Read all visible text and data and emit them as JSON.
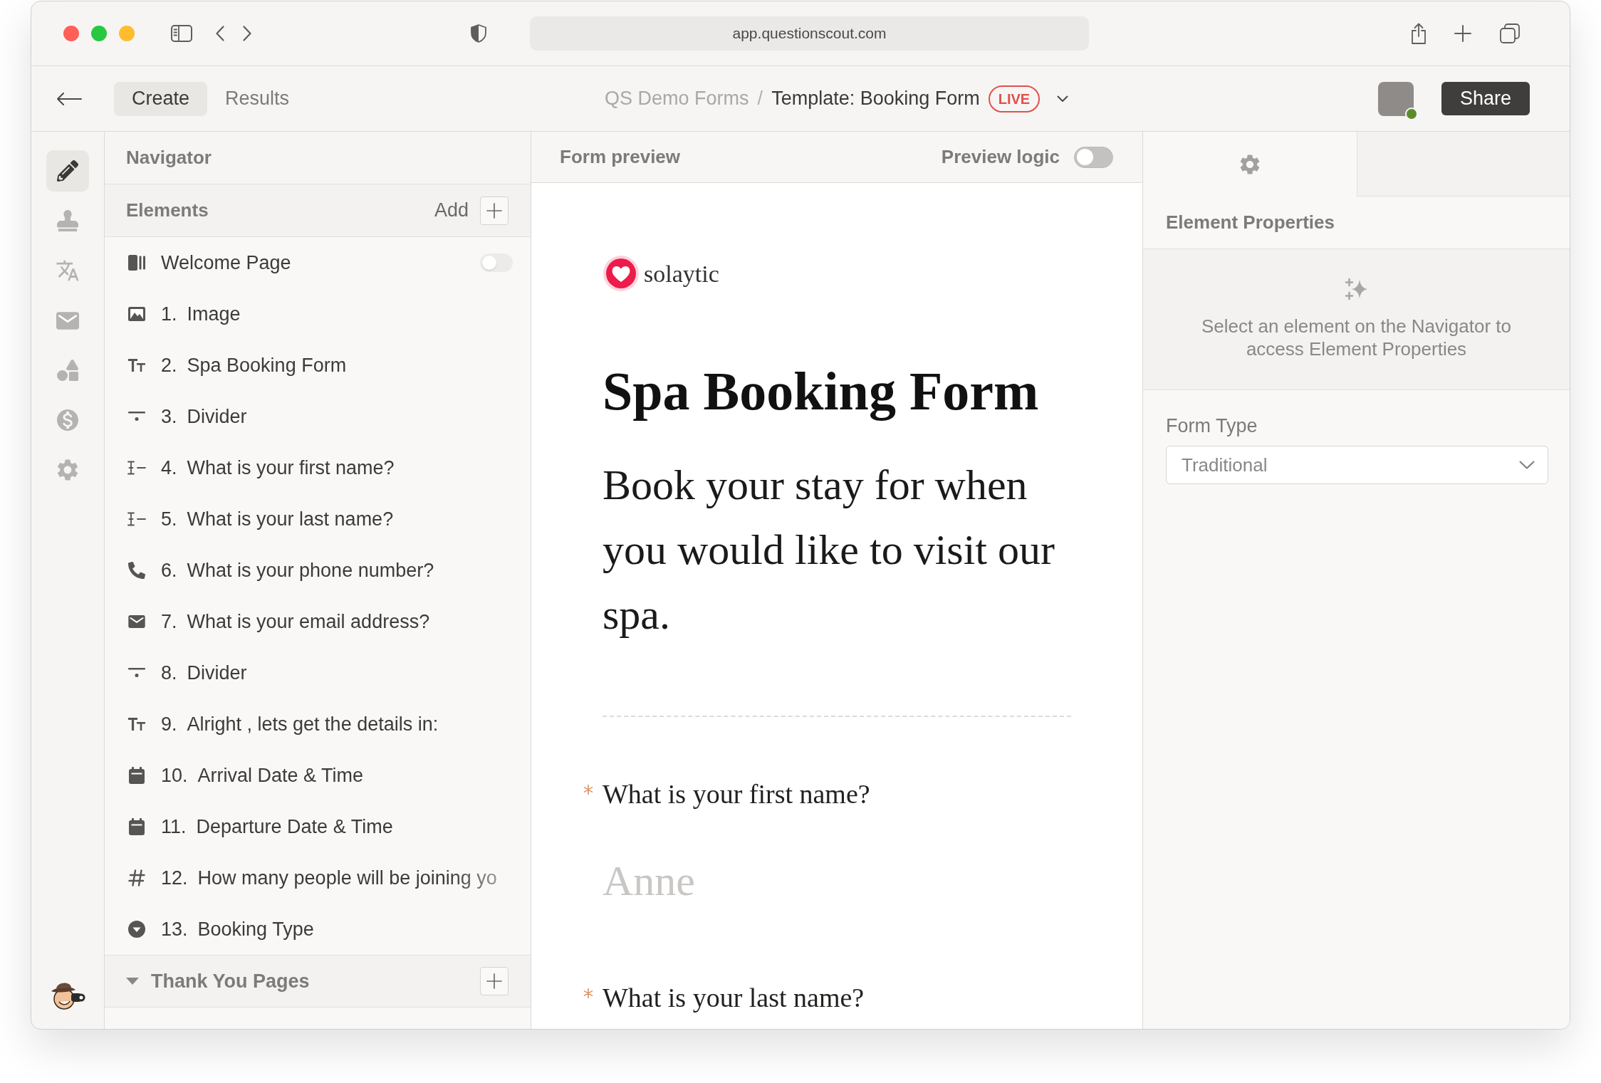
{
  "browser": {
    "url": "app.questionscout.com"
  },
  "header": {
    "tabs": [
      {
        "label": "Create",
        "selected": true
      },
      {
        "label": "Results",
        "selected": false
      }
    ],
    "breadcrumb": {
      "parent": "QS Demo Forms",
      "separator": "/",
      "current": "Template: Booking Form",
      "status": "LIVE"
    },
    "user": {
      "online": true
    },
    "share_button": "Share"
  },
  "sidebar": {
    "items": [
      {
        "kind": "edit",
        "selected": true
      },
      {
        "kind": "design",
        "selected": false
      },
      {
        "kind": "translate",
        "selected": false
      },
      {
        "kind": "email",
        "selected": false
      },
      {
        "kind": "logic",
        "selected": false
      },
      {
        "kind": "payments",
        "selected": false
      },
      {
        "kind": "settings",
        "selected": false
      }
    ]
  },
  "navigator": {
    "title": "Navigator",
    "elements_label": "Elements",
    "add_label": "Add",
    "items": [
      {
        "kind": "welcome",
        "label": "Welcome Page",
        "enabled": false
      },
      {
        "kind": "image",
        "number": "1.",
        "label": "Image"
      },
      {
        "kind": "text",
        "number": "2.",
        "label": "Spa Booking Form"
      },
      {
        "kind": "divider",
        "number": "3.",
        "label": "Divider"
      },
      {
        "kind": "short_text",
        "number": "4.",
        "label": "What is your first name?"
      },
      {
        "kind": "short_text",
        "number": "5.",
        "label": "What is your last name?"
      },
      {
        "kind": "phone",
        "number": "6.",
        "label": "What is your phone number?"
      },
      {
        "kind": "email",
        "number": "7.",
        "label": "What is your email address?"
      },
      {
        "kind": "divider",
        "number": "8.",
        "label": "Divider"
      },
      {
        "kind": "text",
        "number": "9.",
        "label": "Alright , lets get the details in:"
      },
      {
        "kind": "date",
        "number": "10.",
        "label": "Arrival Date & Time"
      },
      {
        "kind": "date",
        "number": "11.",
        "label": "Departure Date & Time"
      },
      {
        "kind": "number",
        "number": "12.",
        "label": "How many people will be joining yo"
      },
      {
        "kind": "dropdown",
        "number": "13.",
        "label": "Booking Type"
      }
    ],
    "thank_you": {
      "label": "Thank You Pages",
      "expanded": true
    }
  },
  "preview": {
    "title": "Form preview",
    "logic_label": "Preview logic",
    "logic_on": false,
    "logo_text": "solaytic",
    "form_title": "Spa Booking Form",
    "description": "Book your stay for when you would like to visit our spa.",
    "questions": [
      {
        "label": "What is your first name?",
        "required": true,
        "placeholder": "Anne"
      },
      {
        "label": "What is your last name?",
        "required": true
      }
    ]
  },
  "properties": {
    "tabs": [
      {
        "kind": "settings",
        "selected": true
      },
      {
        "kind": "blank",
        "selected": false
      }
    ],
    "title": "Element Properties",
    "empty_message": "Select an element on the Navigator to access Element Properties",
    "form_type": {
      "label": "Form Type",
      "value": "Traditional"
    }
  }
}
